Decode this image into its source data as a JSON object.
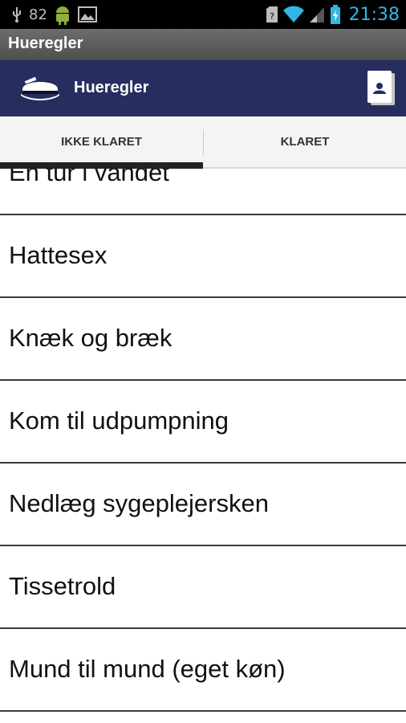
{
  "status_bar": {
    "notification_count": "82",
    "clock": "21:38",
    "icons": [
      "usb-icon",
      "android-icon",
      "image-icon",
      "sim-icon",
      "wifi-icon",
      "signal-icon",
      "battery-icon"
    ],
    "clock_color": "#33b5e5"
  },
  "window": {
    "title": "Hueregler"
  },
  "action_bar": {
    "title": "Hueregler",
    "logo_icon": "student-cap-icon",
    "action_icon": "contact-card-icon",
    "background": "#282d60"
  },
  "tabs": [
    {
      "label": "IKKE KLARET",
      "selected": true
    },
    {
      "label": "KLARET",
      "selected": false
    }
  ],
  "list": {
    "items": [
      "En tur i vandet",
      "Hattesex",
      "Knæk og bræk",
      "Kom til udpumpning",
      "Nedlæg sygeplejersken",
      "Tissetrold",
      "Mund til mund (eget køn)"
    ]
  }
}
